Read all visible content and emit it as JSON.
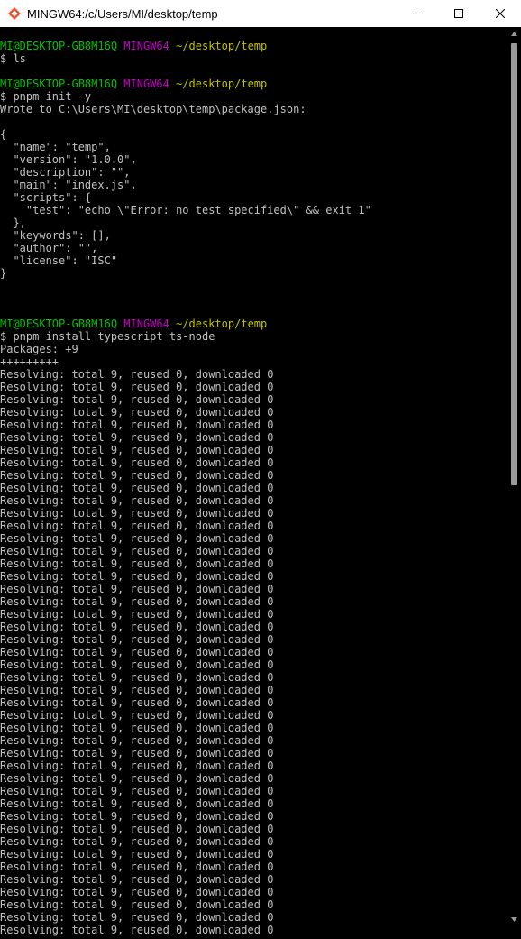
{
  "window": {
    "title": "MINGW64:/c/Users/MI/desktop/temp",
    "controls": [
      "minimize",
      "maximize",
      "close"
    ]
  },
  "colors": {
    "background": "#000000",
    "text": "#c0c0c0",
    "user_host": "#00c000",
    "mingw": "#c000c0",
    "path": "#c0c000",
    "titlebar": "#ffffff"
  },
  "terminal": {
    "lines": [
      {
        "type": "prompt",
        "user": "MI@DESKTOP-GB8M16Q",
        "env": "MINGW64",
        "path": "~/desktop/temp"
      },
      {
        "type": "text",
        "text": "$ ls"
      },
      {
        "type": "text",
        "text": ""
      },
      {
        "type": "prompt",
        "user": "MI@DESKTOP-GB8M16Q",
        "env": "MINGW64",
        "path": "~/desktop/temp"
      },
      {
        "type": "text",
        "text": "$ pnpm init -y"
      },
      {
        "type": "text",
        "text": "Wrote to C:\\Users\\MI\\desktop\\temp\\package.json:"
      },
      {
        "type": "text",
        "text": ""
      },
      {
        "type": "text",
        "text": "{"
      },
      {
        "type": "text",
        "text": "  \"name\": \"temp\","
      },
      {
        "type": "text",
        "text": "  \"version\": \"1.0.0\","
      },
      {
        "type": "text",
        "text": "  \"description\": \"\","
      },
      {
        "type": "text",
        "text": "  \"main\": \"index.js\","
      },
      {
        "type": "text",
        "text": "  \"scripts\": {"
      },
      {
        "type": "text",
        "text": "    \"test\": \"echo \\\"Error: no test specified\\\" && exit 1\""
      },
      {
        "type": "text",
        "text": "  },"
      },
      {
        "type": "text",
        "text": "  \"keywords\": [],"
      },
      {
        "type": "text",
        "text": "  \"author\": \"\","
      },
      {
        "type": "text",
        "text": "  \"license\": \"ISC\""
      },
      {
        "type": "text",
        "text": "}"
      },
      {
        "type": "text",
        "text": ""
      },
      {
        "type": "text",
        "text": ""
      },
      {
        "type": "text",
        "text": ""
      },
      {
        "type": "prompt",
        "user": "MI@DESKTOP-GB8M16Q",
        "env": "MINGW64",
        "path": "~/desktop/temp"
      },
      {
        "type": "text",
        "text": "$ pnpm install typescript ts-node"
      },
      {
        "type": "text",
        "text": "Packages: +9"
      },
      {
        "type": "text",
        "text": "+++++++++"
      }
    ],
    "resolving_line": "Resolving: total 9, reused 0, downloaded 0",
    "resolving_count": 45
  },
  "scrollbar": {
    "position_fraction": 0.0,
    "visible_fraction": 0.49
  }
}
